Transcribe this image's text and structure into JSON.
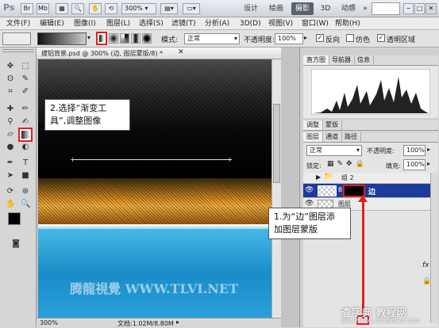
{
  "appbar": {
    "logo": "Ps",
    "zoom": "300%",
    "workspaces": [
      "设计",
      "绘画",
      "摄影",
      "3D",
      "动感"
    ],
    "active_workspace": "摄影",
    "ws_arrow": "»"
  },
  "menu": [
    "文件(F)",
    "编辑(E)",
    "图像(I)",
    "图层(L)",
    "选择(S)",
    "滤镜(T)",
    "分析(A)",
    "3D(D)",
    "视图(V)",
    "窗口(W)",
    "帮助(H)"
  ],
  "options": {
    "mode_label": "模式:",
    "mode_value": "正常",
    "opacity_label": "不透明度:",
    "opacity_value": "100%",
    "reverse_label": "反向",
    "dither_label": "仿色",
    "transparency_label": "透明区域"
  },
  "document": {
    "tab_title": "拔铝背景.psd @ 300% (边, 图层蒙版/8) *",
    "zoom": "300%",
    "doc_info": "文档:1.02M/8.80M",
    "watermark": "腾龍視覺 WWW.TLVI.NET"
  },
  "panels": {
    "histogram_tabs": [
      "直方图",
      "导航器",
      "信息"
    ],
    "adjust_tabs": [
      "调整",
      "蒙版"
    ],
    "layer_tabs": [
      "图层",
      "通道",
      "路径"
    ],
    "blend_mode": "正常",
    "opacity_label": "不透明度:",
    "opacity_value": "100%",
    "lock_label": "锁定:",
    "fill_label": "填充:",
    "fill_value": "100%",
    "layers": [
      {
        "name": "组 2",
        "type": "group"
      },
      {
        "name": "边",
        "type": "layer",
        "selected": true
      },
      {
        "name": "图层",
        "type": "layer"
      }
    ],
    "fx_label": "fx"
  },
  "callouts": {
    "step2": [
      "2.选择“渐变工",
      "具”,调整图像"
    ],
    "step1": [
      "1.为“边”图层添",
      "加图层蒙版"
    ]
  },
  "site_watermark": "查字典 教程网",
  "site_url": "jiaocheng.chazidian.com",
  "colors": {
    "accent_red": "#e0201e",
    "selected_layer": "#1a3a9c"
  }
}
